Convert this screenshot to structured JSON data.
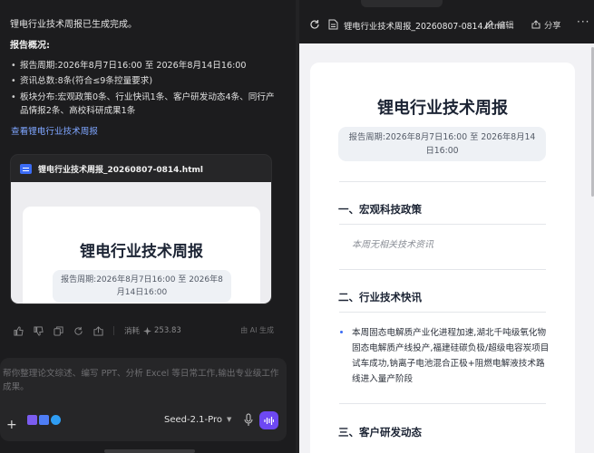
{
  "chat": {
    "completion_msg": "锂电行业技术周报已生成完成。",
    "overview_heading": "报告概况:",
    "bullets": [
      "报告周期:2026年8月7日16:00 至 2026年8月14日16:00",
      "资讯总数:8条(符合≤9条控量要求)",
      "板块分布:宏观政策0条、行业快讯1条、客户研发动态4条、同行产品情报2条、高校科研成果1条"
    ],
    "view_link": "查看锂电行业技术周报",
    "file_card": {
      "filename": "锂电行业技术周报_20260807-0814.html",
      "preview_title": "锂电行业技术周报",
      "preview_period": "报告周期:2026年8月7日16:00 至 2026年8月14日16:00"
    },
    "actions": {
      "cost_label": "消耗",
      "cost_value": "253.83",
      "ai_generated": "由 AI 生成"
    },
    "input": {
      "placeholder": "帮你整理论文综述、编写 PPT、分析 Excel 等日常工作,输出专业级工作成果。",
      "model": "Seed-2.1-Pro"
    }
  },
  "viewer": {
    "filename": "锂电行业技术周报_20260807-0814.html",
    "edit_label": "编辑",
    "share_label": "分享",
    "doc": {
      "title": "锂电行业技术周报",
      "period": "报告周期:2026年8月7日16:00 至 2026年8月14日16:00",
      "sections": [
        {
          "heading": "一、宏观科技政策",
          "empty_text": "本周无相关技术资讯"
        },
        {
          "heading": "二、行业技术快讯",
          "item": "本周固态电解质产业化进程加速,湖北千吨级氧化物固态电解质产线投产,福建硅碳负极/超级电容炭项目试车成功,钠离子电池混合正极+阻燃电解液技术路线进入量产阶段"
        },
        {
          "heading": "三、客户研发动态"
        }
      ]
    }
  },
  "colors": {
    "accent": "#6d48f3",
    "link": "#7ea5ff",
    "bullet_accent": "#3b6cf6"
  }
}
